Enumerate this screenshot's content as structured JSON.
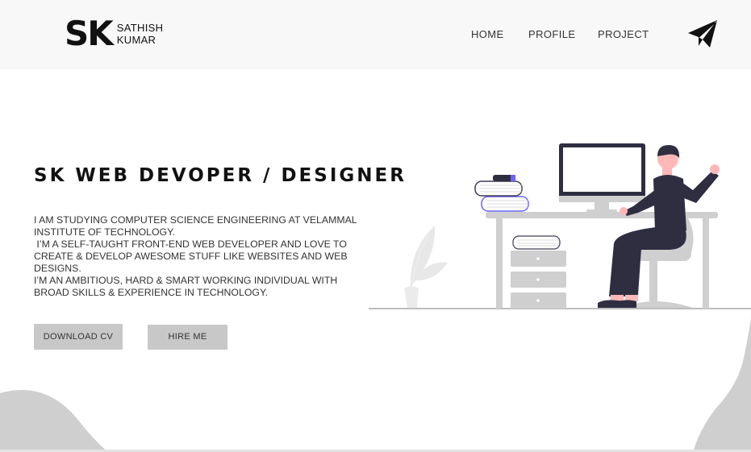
{
  "header": {
    "logo_mark": "SK",
    "logo_line1": "SATHISH",
    "logo_line2": "KUMAR",
    "nav": [
      "HOME",
      "PROFILE",
      "PROJECT"
    ],
    "send_icon": "paper-plane-icon"
  },
  "hero": {
    "title": "SK WEB DEVOPER / DESIGNER",
    "paragraphs": [
      "I AM STUDYING COMPUTER SCIENCE ENGINEERING AT VELAMMAL INSTITUTE OF TECHNOLOGY.",
      " I’M A SELF-TAUGHT FRONT-END WEB DEVELOPER AND LOVE TO CREATE & DEVELOP AWESOME STUFF LIKE WEBSITES AND WEB DESIGNS.",
      "I’M AN AMBITIOUS, HARD & SMART WORKING INDIVIDUAL WITH BROAD SKILLS & EXPERIENCE IN TECHNOLOGY."
    ],
    "buttons": {
      "download_cv": "DOWNLOAD CV",
      "hire_me": "HIRE ME"
    }
  },
  "colors": {
    "header_bg": "#f8f8f8",
    "button_bg": "#c8c8c8",
    "accent": "#6c63ff",
    "shirt": "#2f2e41",
    "skin": "#ffb8b8",
    "illustration_gray": "#cfcfcf"
  }
}
